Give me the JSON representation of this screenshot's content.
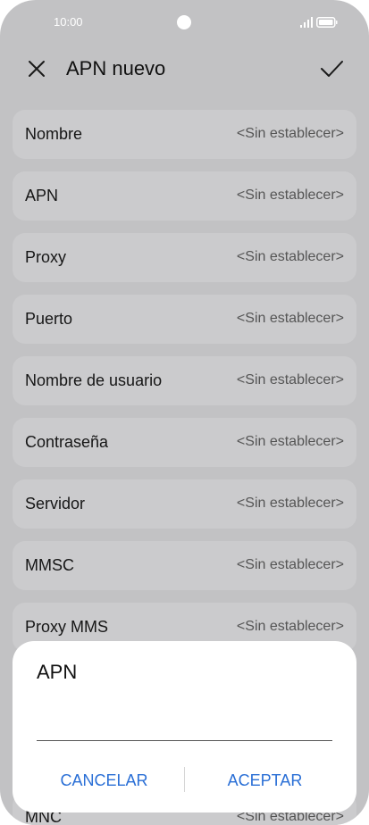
{
  "status_bar": {
    "time": "10:00",
    "icons": [
      "camera-icon",
      "signal-icon",
      "battery-icon"
    ]
  },
  "header": {
    "title": "APN nuevo",
    "close_icon": "close-icon",
    "confirm_icon": "check-icon"
  },
  "fields": [
    {
      "label": "Nombre",
      "value": "<Sin establecer>"
    },
    {
      "label": "APN",
      "value": "<Sin establecer>"
    },
    {
      "label": "Proxy",
      "value": "<Sin establecer>"
    },
    {
      "label": "Puerto",
      "value": "<Sin establecer>"
    },
    {
      "label": "Nombre de usuario",
      "value": "<Sin establecer>"
    },
    {
      "label": "Contraseña",
      "value": "<Sin establecer>"
    },
    {
      "label": "Servidor",
      "value": "<Sin establecer>"
    },
    {
      "label": "MMSC",
      "value": "<Sin establecer>"
    },
    {
      "label": "Proxy MMS",
      "value": "<Sin establecer>"
    },
    {
      "label": "MNC",
      "value": "<Sin establecer>"
    }
  ],
  "dialog": {
    "title": "APN",
    "input_value": "",
    "cancel_label": "CANCELAR",
    "ok_label": "ACEPTAR"
  },
  "colors": {
    "accent": "#2a6fd6",
    "scrim_background": "#c2c2c4",
    "row_background": "#cbcbcd"
  }
}
